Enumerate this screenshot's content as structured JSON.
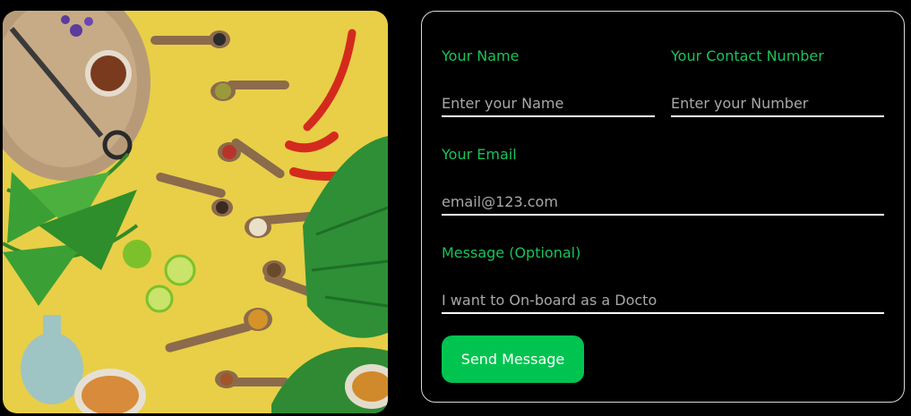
{
  "photo": {
    "description_icon": "spices-photo-icon"
  },
  "form": {
    "name_label": "Your Name",
    "name_placeholder": "Enter your Name",
    "contact_label": "Your Contact Number",
    "contact_placeholder": "Enter your Number",
    "email_label": "Your Email",
    "email_placeholder": "email@123.com",
    "message_label": "Message (Optional)",
    "message_placeholder": "I want to On-board as a Docto",
    "send_label": "Send Message"
  },
  "colors": {
    "accent": "#00c44f",
    "label": "#19c35a",
    "background": "#000000",
    "photo_bg": "#e9d34a"
  }
}
